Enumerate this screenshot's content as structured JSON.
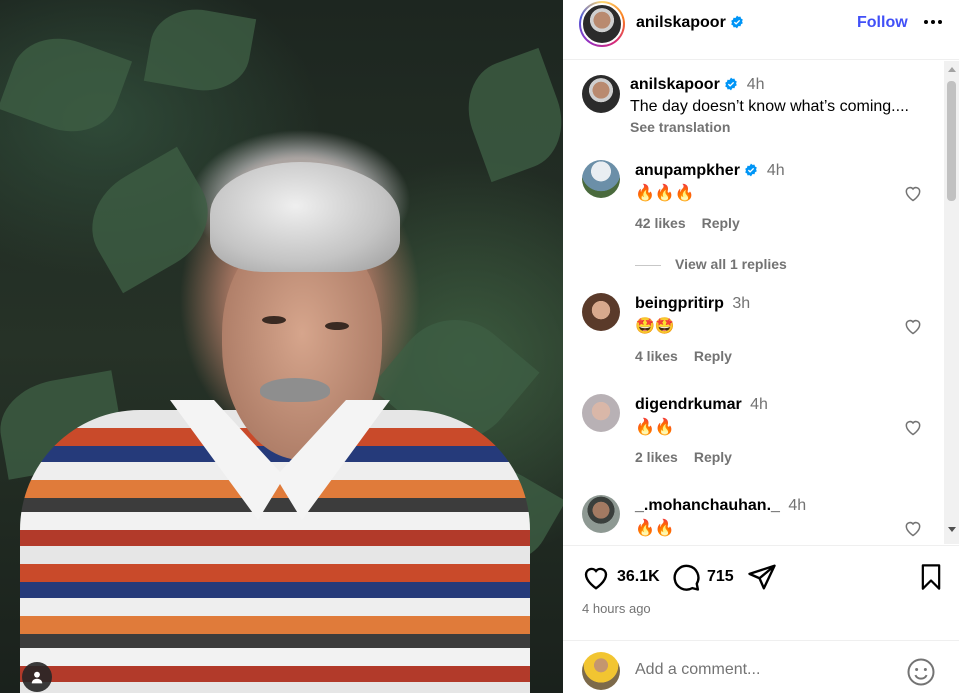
{
  "post": {
    "author": "anilskapoor",
    "follow_label": "Follow",
    "caption_author": "anilskapoor",
    "caption_time": "4h",
    "caption_text": "The day doesn’t know what’s coming....",
    "see_translation": "See translation"
  },
  "comments": [
    {
      "user": "anupampkher",
      "verified": true,
      "time": "4h",
      "text": "🔥🔥🔥",
      "likes": "42 likes",
      "reply": "Reply",
      "avatar_color": "#6b8fa8"
    },
    {
      "user": "beingpritirp",
      "verified": false,
      "time": "3h",
      "text": "🤩🤩",
      "likes": "4 likes",
      "reply": "Reply",
      "avatar_color": "#a07a5a"
    },
    {
      "user": "digendrkumar",
      "verified": false,
      "time": "4h",
      "text": "🔥🔥",
      "likes": "2 likes",
      "reply": "Reply",
      "avatar_color": "#b8b1b5"
    },
    {
      "user": "_.mohanchauhan._",
      "verified": false,
      "time": "4h",
      "text": "🔥🔥",
      "likes": "",
      "reply": "",
      "avatar_color": "#6f7a74"
    }
  ],
  "view_replies": "View all 1 replies",
  "actions": {
    "likes_count": "36.1K",
    "comments_count": "715",
    "time_ago": "4 hours ago"
  },
  "add_comment": {
    "placeholder": "Add a comment..."
  },
  "colors": {
    "accent": "#4150f7",
    "verified": "#0095f6",
    "muted": "#737373"
  },
  "icons": [
    "user-icon",
    "more-icon",
    "verified-badge-icon",
    "heart-icon",
    "comment-icon",
    "share-icon",
    "bookmark-icon",
    "emoji-icon"
  ]
}
